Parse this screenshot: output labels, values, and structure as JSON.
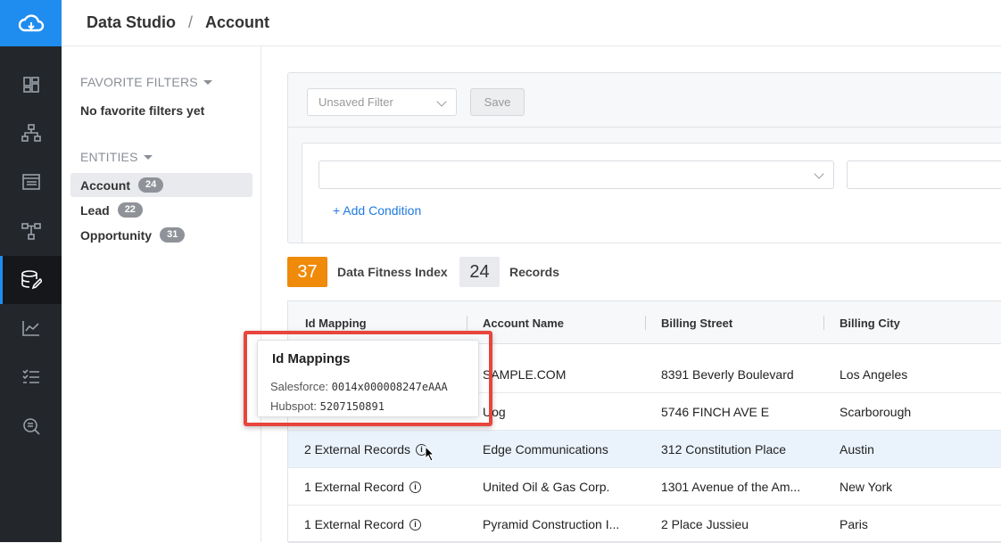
{
  "breadcrumb": {
    "root": "Data Studio",
    "separator": "/",
    "current": "Account"
  },
  "rail": {
    "items": [
      {
        "icon": "dashboard-icon"
      },
      {
        "icon": "hierarchy-icon"
      },
      {
        "icon": "list-icon"
      },
      {
        "icon": "workflow-icon"
      },
      {
        "icon": "data-studio-icon",
        "active": true
      },
      {
        "icon": "chart-icon"
      },
      {
        "icon": "checklist-icon"
      },
      {
        "icon": "search-list-icon"
      }
    ]
  },
  "sidebar": {
    "favorites_heading": "FAVORITE FILTERS",
    "favorites_empty": "No favorite filters yet",
    "entities_heading": "ENTITIES",
    "entities": [
      {
        "label": "Account",
        "count": "24"
      },
      {
        "label": "Lead",
        "count": "22"
      },
      {
        "label": "Opportunity",
        "count": "31"
      }
    ]
  },
  "filter": {
    "select_placeholder": "Unsaved Filter",
    "save_label": "Save",
    "add_condition_label": "+ Add Condition"
  },
  "metrics": {
    "fitness_value": "37",
    "fitness_label": "Data Fitness Index",
    "records_value": "24",
    "records_label": "Records"
  },
  "table": {
    "columns": [
      "Id Mapping",
      "Account Name",
      "Billing Street",
      "Billing City"
    ],
    "rows": [
      {
        "id_mapping": "",
        "account": "SAMPLE.COM",
        "street": "8391 Beverly Boulevard",
        "city": "Los Angeles"
      },
      {
        "id_mapping": "",
        "account": "Uog",
        "street": "5746 FINCH AVE E",
        "city": "Scarborough"
      },
      {
        "id_mapping": "2 External Records",
        "account": "Edge Communications",
        "street": "312 Constitution Place",
        "city": "Austin"
      },
      {
        "id_mapping": "1 External Record",
        "account": "United Oil & Gas Corp.",
        "street": "1301 Avenue of the Am...",
        "city": "New York"
      },
      {
        "id_mapping": "1 External Record",
        "account": "Pyramid Construction I...",
        "street": "2 Place Jussieu",
        "city": "Paris"
      }
    ]
  },
  "tooltip": {
    "title": "Id Mappings",
    "lines": [
      {
        "label": "Salesforce:",
        "value": "0014x000008247eAAA"
      },
      {
        "label": "Hubspot:",
        "value": "5207150891"
      }
    ]
  },
  "colors": {
    "accent": "#1f8cf0",
    "fitness": "#ef8a0a",
    "highlight_border": "#e8453c"
  }
}
